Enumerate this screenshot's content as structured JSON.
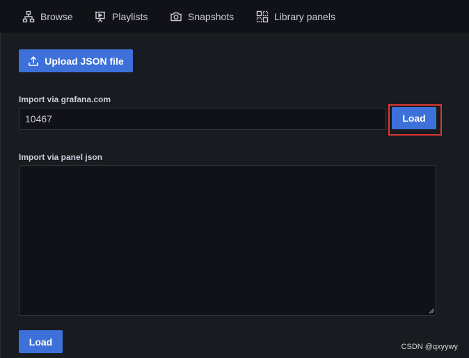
{
  "tabs": [
    {
      "label": "Browse",
      "icon": "sitemap-icon"
    },
    {
      "label": "Playlists",
      "icon": "presentation-icon"
    },
    {
      "label": "Snapshots",
      "icon": "camera-icon"
    },
    {
      "label": "Library panels",
      "icon": "library-panels-icon"
    }
  ],
  "upload": {
    "label": "Upload JSON file",
    "icon": "upload-icon"
  },
  "grafana_import": {
    "label": "Import via grafana.com",
    "value": "10467",
    "button": "Load"
  },
  "panel_json": {
    "label": "Import via panel json",
    "value": "",
    "button": "Load"
  },
  "watermark": "CSDN @qxyywy",
  "colors": {
    "primary": "#3d71d9",
    "highlight": "#e03535",
    "background": "#181b1f",
    "input_bg": "#111217"
  }
}
